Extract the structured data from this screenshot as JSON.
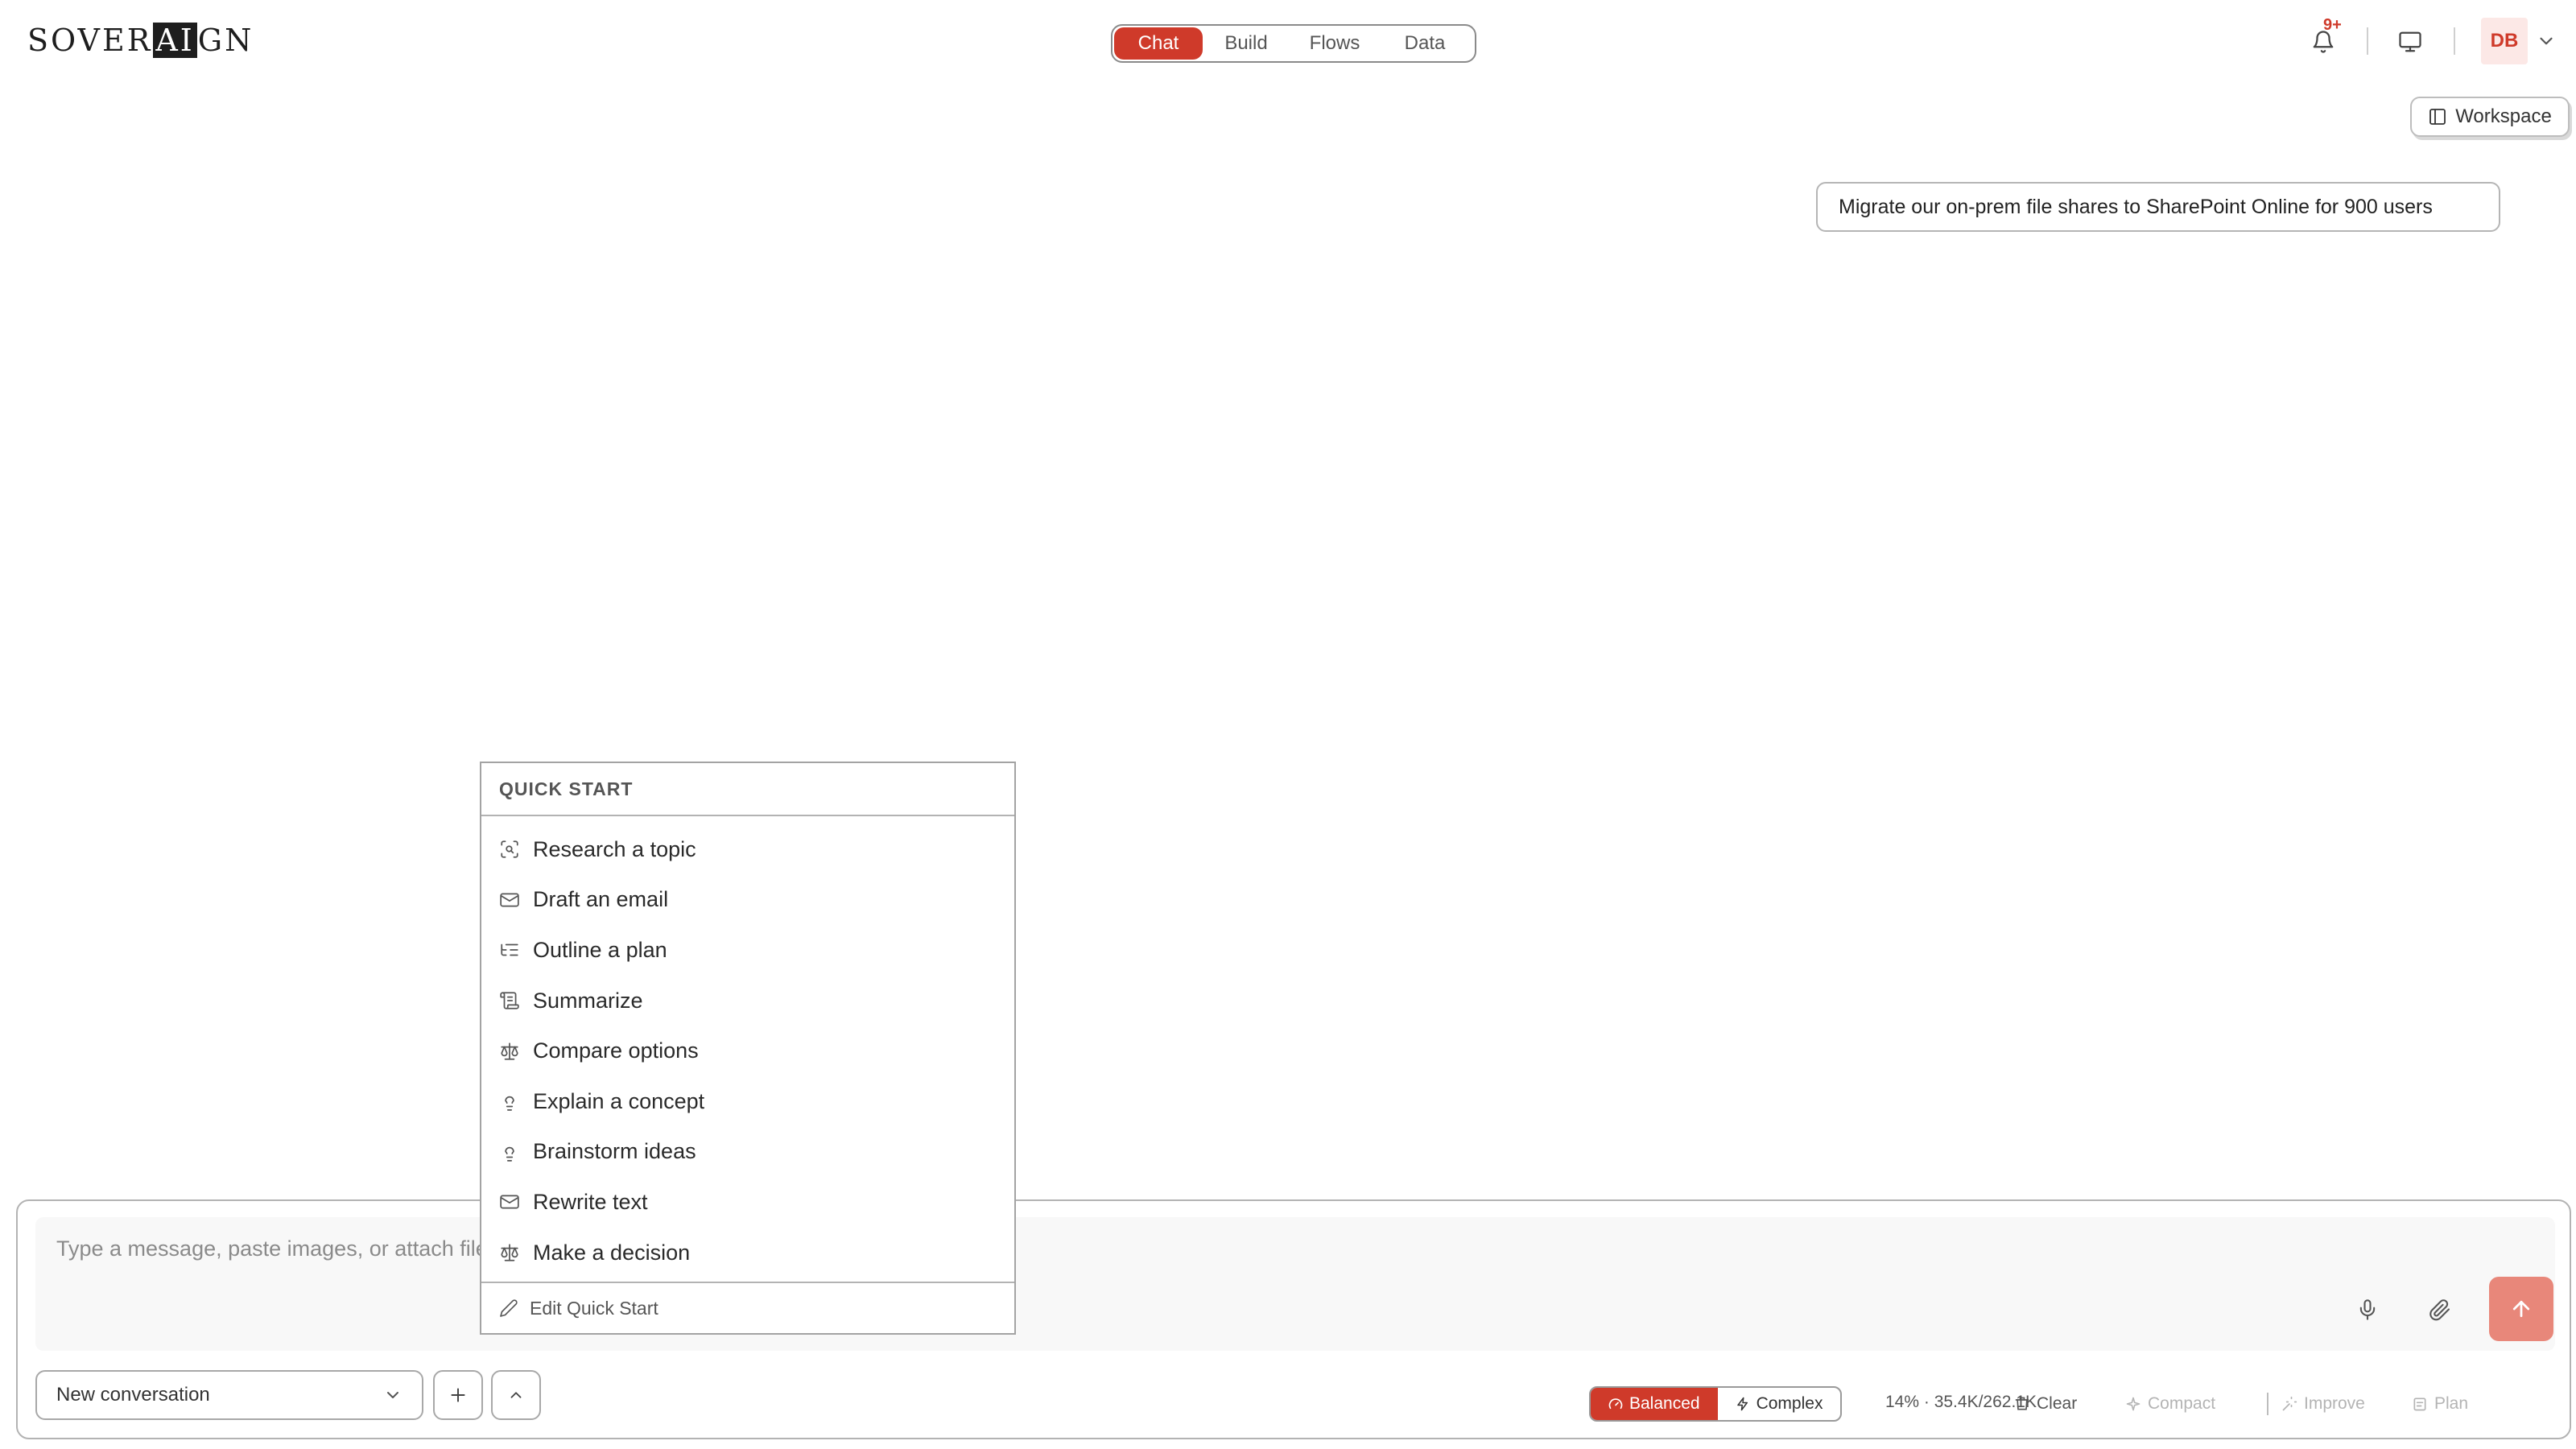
{
  "header": {
    "logo": {
      "before": "SOVER",
      "accent": "AI",
      "after": "GN"
    },
    "tabs": [
      {
        "label": "Chat",
        "active": true
      },
      {
        "label": "Build",
        "active": false
      },
      {
        "label": "Flows",
        "active": false
      },
      {
        "label": "Data",
        "active": false
      }
    ],
    "notifications_badge": "9+",
    "avatar_initials": "DB"
  },
  "workspace_button": {
    "label": "Workspace",
    "icon": "panel-icon"
  },
  "conversation": {
    "user_message": "Migrate our on-prem file shares to SharePoint Online for 900 users"
  },
  "quick_start": {
    "title": "QUICK START",
    "items": [
      {
        "label": "Research a topic",
        "icon": "scan-search-icon"
      },
      {
        "label": "Draft an email",
        "icon": "mail-icon"
      },
      {
        "label": "Outline a plan",
        "icon": "list-tree-icon"
      },
      {
        "label": "Summarize",
        "icon": "scroll-text-icon"
      },
      {
        "label": "Compare options",
        "icon": "scale-icon"
      },
      {
        "label": "Explain a concept",
        "icon": "lightbulb-icon"
      },
      {
        "label": "Brainstorm ideas",
        "icon": "lightbulb-icon"
      },
      {
        "label": "Rewrite text",
        "icon": "mail-icon"
      },
      {
        "label": "Make a decision",
        "icon": "scale-icon"
      }
    ],
    "edit_label": "Edit Quick Start"
  },
  "composer": {
    "placeholder": "Type a message, paste images, or attach files...",
    "conversation_select": "New conversation",
    "modes": [
      {
        "label": "Balanced",
        "active": true
      },
      {
        "label": "Complex",
        "active": false
      }
    ],
    "usage": "14% · 35.4K/262.1K",
    "tools": [
      {
        "label": "Clear",
        "enabled": true
      },
      {
        "label": "Compact",
        "enabled": false
      },
      {
        "label": "Improve",
        "enabled": false
      },
      {
        "label": "Plan",
        "enabled": false
      }
    ]
  },
  "colors": {
    "accent": "#cf3a2a",
    "send_button": "#e8877a",
    "avatar_bg": "#fce8e6"
  }
}
